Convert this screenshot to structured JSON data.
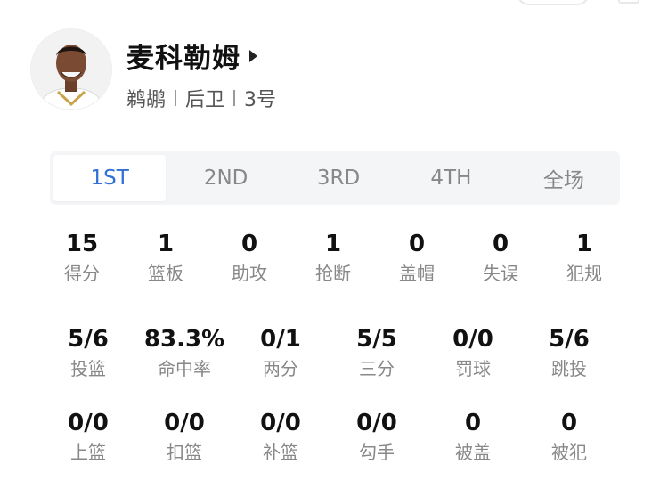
{
  "player": {
    "name": "麦科勒姆",
    "team": "鹈鹕",
    "position": "后卫",
    "number": "3号"
  },
  "tabs": [
    "1ST",
    "2ND",
    "3RD",
    "4TH",
    "全场"
  ],
  "active_tab": "1ST",
  "stats_row1": [
    {
      "value": "15",
      "label": "得分"
    },
    {
      "value": "1",
      "label": "篮板"
    },
    {
      "value": "0",
      "label": "助攻"
    },
    {
      "value": "1",
      "label": "抢断"
    },
    {
      "value": "0",
      "label": "盖帽"
    },
    {
      "value": "0",
      "label": "失误"
    },
    {
      "value": "1",
      "label": "犯规"
    }
  ],
  "stats_row2": [
    {
      "value": "5/6",
      "label": "投篮"
    },
    {
      "value": "83.3%",
      "label": "命中率"
    },
    {
      "value": "0/1",
      "label": "两分"
    },
    {
      "value": "5/5",
      "label": "三分"
    },
    {
      "value": "0/0",
      "label": "罚球"
    },
    {
      "value": "5/6",
      "label": "跳投"
    }
  ],
  "stats_row3": [
    {
      "value": "0/0",
      "label": "上篮"
    },
    {
      "value": "0/0",
      "label": "扣篮"
    },
    {
      "value": "0/0",
      "label": "补篮"
    },
    {
      "value": "0/0",
      "label": "勾手"
    },
    {
      "value": "0",
      "label": "被盖"
    },
    {
      "value": "0",
      "label": "被犯"
    }
  ],
  "colors": {
    "accent": "#2f6fd6",
    "label": "#888888",
    "value": "#111111",
    "tab_bg": "#f4f5f7"
  },
  "icons": {
    "arrow": "triangle-right-icon",
    "avatar": "player-avatar"
  }
}
